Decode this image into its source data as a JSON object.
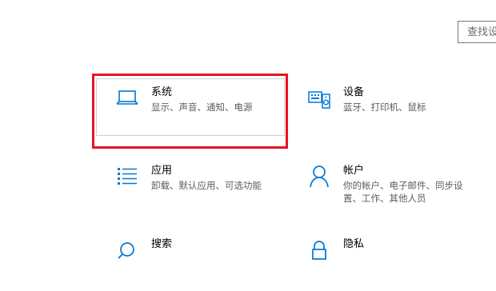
{
  "search": {
    "placeholder": "查找设"
  },
  "tiles": [
    {
      "title": "系统",
      "desc": "显示、声音、通知、电源",
      "icon": "laptop-icon"
    },
    {
      "title": "设备",
      "desc": "蓝牙、打印机、鼠标",
      "icon": "keyboard-speaker-icon"
    },
    {
      "title": "应用",
      "desc": "卸载、默认应用、可选功能",
      "icon": "apps-list-icon"
    },
    {
      "title": "帐户",
      "desc": "你的帐户、电子邮件、同步设置、工作、其他人员",
      "icon": "person-icon"
    },
    {
      "title": "搜索",
      "desc": "",
      "icon": "search-icon"
    },
    {
      "title": "隐私",
      "desc": "",
      "icon": "lock-icon"
    }
  ],
  "colors": {
    "accent": "#0078d7",
    "highlight": "#e81123"
  }
}
